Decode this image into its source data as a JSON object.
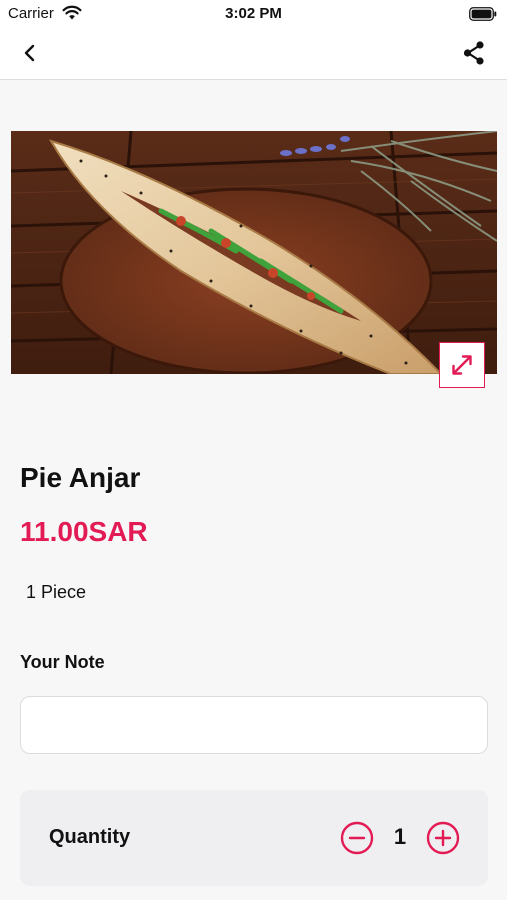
{
  "status_bar": {
    "carrier": "Carrier",
    "time": "3:02 PM",
    "icons": [
      "wifi-icon",
      "battery-icon"
    ]
  },
  "nav": {
    "icons": [
      "chevron-left-icon",
      "share-icon"
    ]
  },
  "product": {
    "image_desc_icon": "expand-icon",
    "title": "Pie Anjar",
    "price": "11.00SAR",
    "unit": "1 Piece"
  },
  "note": {
    "label": "Your Note",
    "value": "",
    "placeholder": ""
  },
  "quantity": {
    "label": "Quantity",
    "value": "1"
  },
  "colors": {
    "accent": "#e31b54",
    "background": "#f7f7f8",
    "card": "#efeff2"
  }
}
